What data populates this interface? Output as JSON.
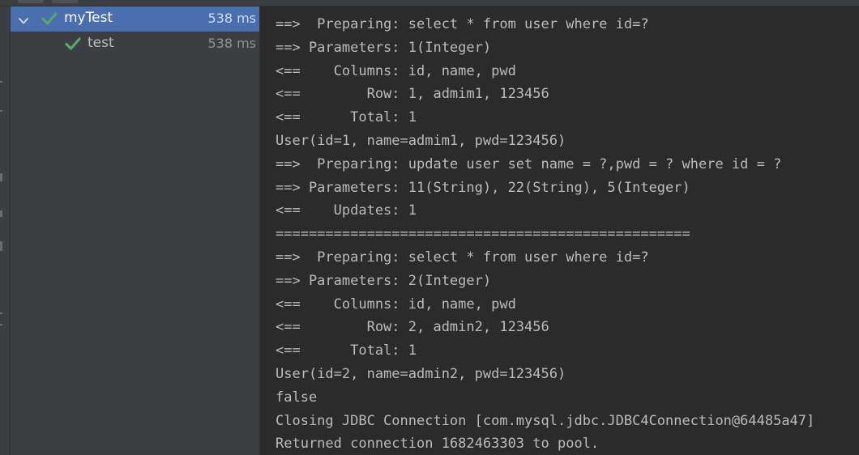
{
  "test_tree": {
    "suite": {
      "name": "myTest",
      "duration": "538 ms",
      "status": "passed"
    },
    "tests": [
      {
        "name": "test",
        "duration": "538 ms",
        "status": "passed"
      }
    ]
  },
  "console": {
    "lines": [
      "==>  Preparing: select * from user where id=?",
      "==> Parameters: 1(Integer)",
      "<==    Columns: id, name, pwd",
      "<==        Row: 1, admim1, 123456",
      "<==      Total: 1",
      "User(id=1, name=admim1, pwd=123456)",
      "==>  Preparing: update user set name = ?,pwd = ? where id = ?",
      "==> Parameters: 11(String), 22(String), 5(Integer)",
      "<==    Updates: 1",
      "==================================================",
      "==>  Preparing: select * from user where id=?",
      "==> Parameters: 2(Integer)",
      "<==    Columns: id, name, pwd",
      "<==        Row: 2, admin2, 123456",
      "<==      Total: 1",
      "User(id=2, name=admin2, pwd=123456)",
      "false",
      "Closing JDBC Connection [com.mysql.jdbc.JDBC4Connection@64485a47]",
      "Returned connection 1682463303 to pool."
    ]
  },
  "colors": {
    "selection": "#4b6eaf",
    "pass_check": "#59a869",
    "console_bg": "#2b2b2b",
    "panel_bg": "#3c3f41",
    "console_text": "#bbbbbb"
  },
  "icons": {
    "expand": "chevron-down-icon",
    "passed": "check-icon"
  }
}
